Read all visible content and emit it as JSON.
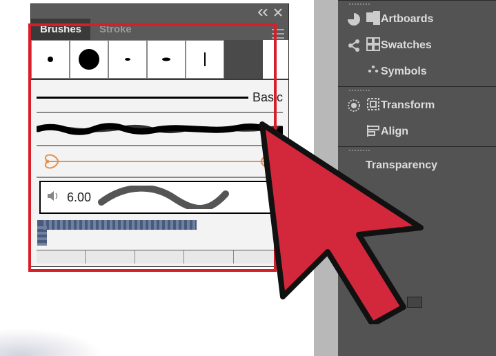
{
  "brushes_panel": {
    "tabs": {
      "brushes": "Brushes",
      "stroke": "Stroke"
    },
    "basic_label": "Basic",
    "scatter_value": "6.00"
  },
  "right_panel": {
    "artboards": "Artboards",
    "swatches": "Swatches",
    "symbols": "Symbols",
    "transform": "Transform",
    "align": "Align",
    "transparency": "Transparency"
  }
}
